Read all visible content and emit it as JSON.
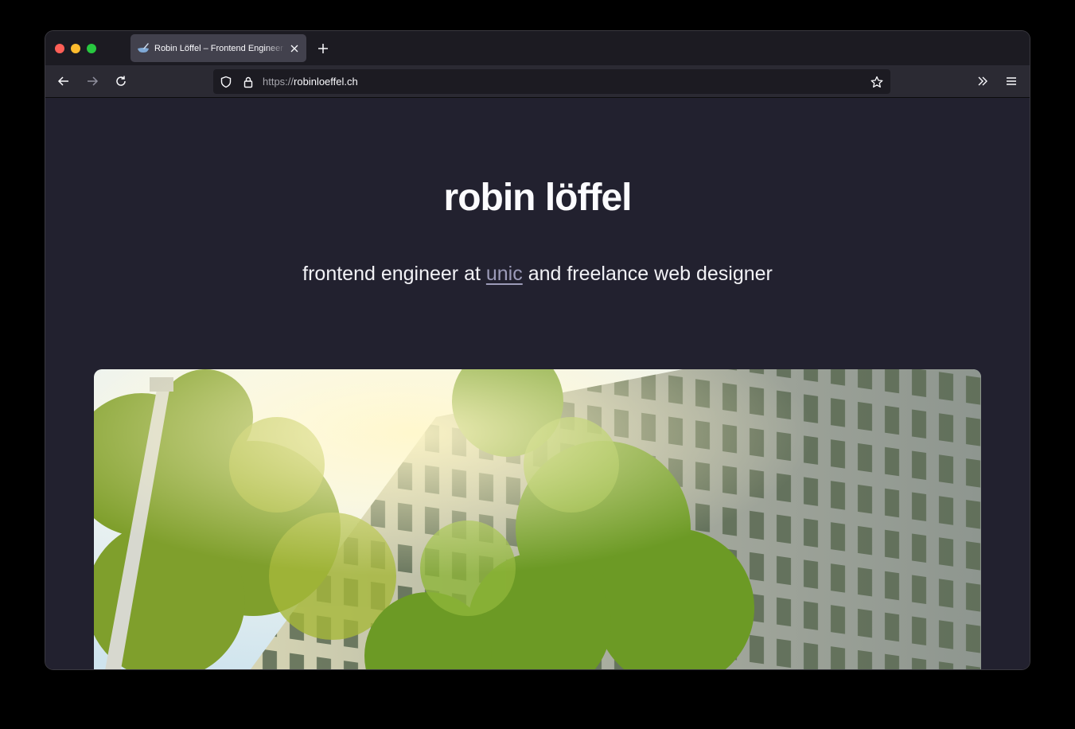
{
  "browser": {
    "tab": {
      "title": "Robin Löffel – Frontend Engineer",
      "close_icon": "close-icon",
      "favicon": "bowl-favicon-icon"
    },
    "new_tab_icon": "plus-icon",
    "nav": {
      "back_icon": "arrow-left-icon",
      "forward_icon": "arrow-right-icon",
      "reload_icon": "reload-icon"
    },
    "url": {
      "scheme": "https://",
      "host": "robinloeffel.ch"
    },
    "url_icons": [
      "shield-icon",
      "lock-icon",
      "star-icon"
    ],
    "toolbar_icons": [
      "overflow-chevrons-icon",
      "hamburger-menu-icon"
    ]
  },
  "page": {
    "heading": "robin löffel",
    "subtitle_before": "frontend engineer at ",
    "subtitle_link": "unic",
    "subtitle_after": " and freelance web designer",
    "hero_image": "office building with trees under sunlight"
  },
  "colors": {
    "page_bg": "#22212f",
    "link": "#9c9bb8",
    "text": "#fbfbfe"
  }
}
